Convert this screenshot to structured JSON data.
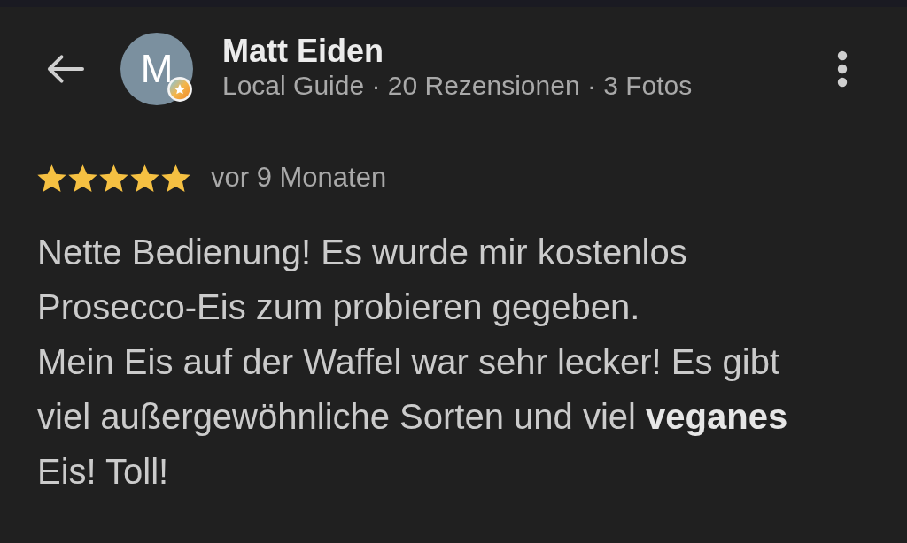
{
  "header": {
    "name": "Matt Eiden",
    "avatar_initial": "M",
    "subtitle": "Local Guide · 20 Rezensionen · 3 Fotos"
  },
  "rating": {
    "stars": 5,
    "time": "vor 9 Monaten"
  },
  "review": {
    "paragraphs": [
      "Nette Bedienung! Es wurde mir kostenlos Prosecco-Eis zum probieren gegeben.",
      "Mein Eis auf der Waffel war sehr lecker! Es gibt viel außergewöhnliche Sorten und viel **veganes** Eis! Toll!"
    ]
  }
}
